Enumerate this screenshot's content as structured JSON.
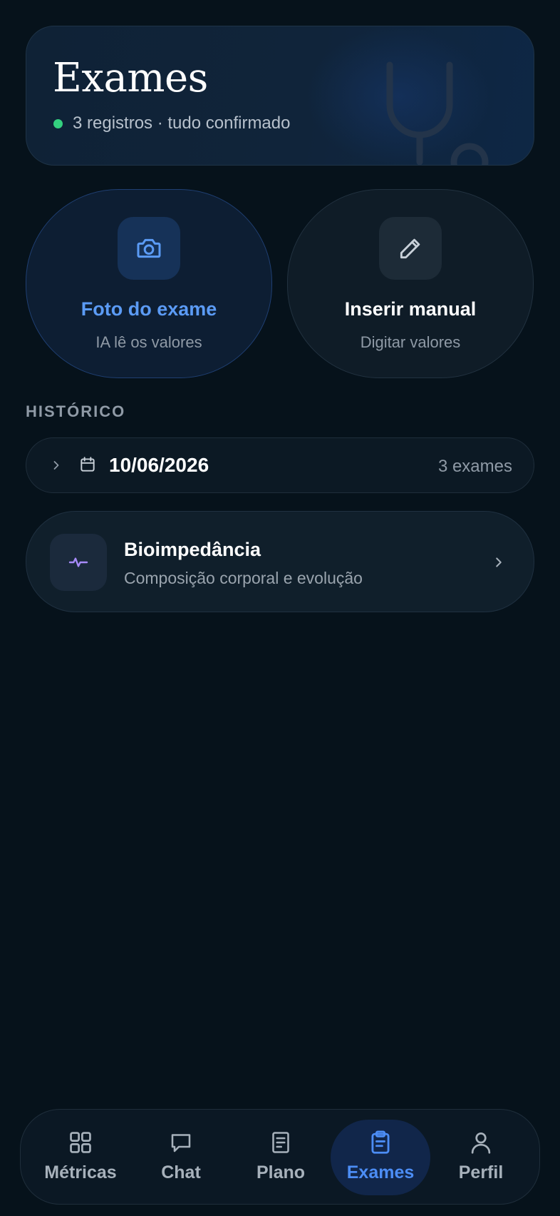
{
  "header": {
    "title": "Exames",
    "status": "3 registros · tudo confirmado",
    "status_color": "#34d07f",
    "decor_icon": "stethoscope-icon"
  },
  "actions": [
    {
      "label": "Foto do exame",
      "sub": "IA lê os valores",
      "icon": "camera-icon",
      "accent": "#5b9bf5"
    },
    {
      "label": "Inserir manual",
      "sub": "Digitar valores",
      "icon": "pencil-icon"
    }
  ],
  "history": {
    "section_label": "HISTÓRICO",
    "date_group": {
      "date": "10/06/2026",
      "count": "3 exames",
      "icon": "calendar-icon",
      "expanded": false
    },
    "items": [
      {
        "title": "Bioimpedância",
        "subtitle": "Composição corporal e evolução",
        "icon": "activity-icon",
        "icon_color": "#a78bfa"
      }
    ]
  },
  "nav": {
    "active": "Exames",
    "active_color": "#4c8df5",
    "items": [
      {
        "label": "Métricas",
        "icon": "grid-icon"
      },
      {
        "label": "Chat",
        "icon": "chat-icon"
      },
      {
        "label": "Plano",
        "icon": "document-icon"
      },
      {
        "label": "Exames",
        "icon": "clipboard-icon"
      },
      {
        "label": "Perfil",
        "icon": "user-icon"
      }
    ]
  }
}
